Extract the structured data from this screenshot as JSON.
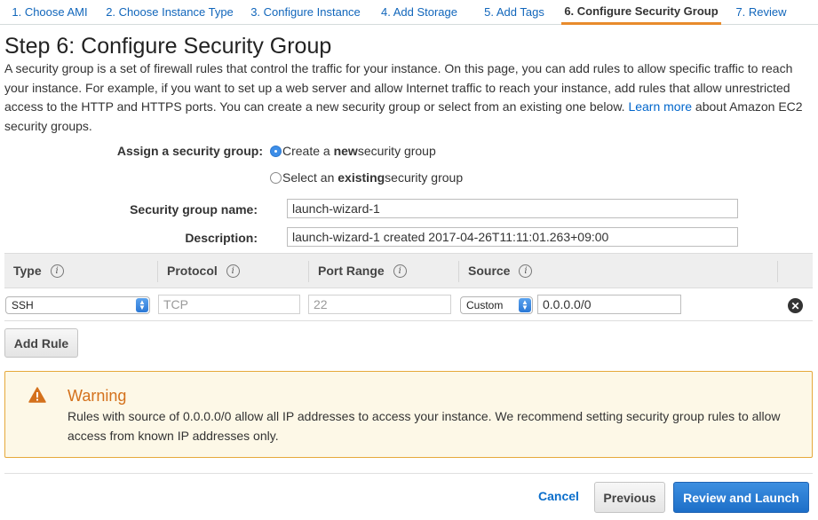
{
  "wizard": {
    "steps": [
      "1. Choose AMI",
      "2. Choose Instance Type",
      "3. Configure Instance",
      "4. Add Storage",
      "5. Add Tags",
      "6. Configure Security Group",
      "7. Review"
    ],
    "active_step": 6
  },
  "page": {
    "title": "Step 6: Configure Security Group",
    "intro_text": "A security group is a set of firewall rules that control the traffic for your instance. On this page, you can add rules to allow specific traffic to reach your instance. For example, if you want to set up a web server and allow Internet traffic to reach your instance, add rules that allow unrestricted access to the HTTP and HTTPS ports. You can create a new security group or select from an existing one below.",
    "learn_more_link": "Learn more",
    "intro_suffix": "about Amazon EC2 security groups."
  },
  "assign": {
    "label": "Assign a security group:",
    "option_new_prefix": "Create a ",
    "option_new_bold": "new",
    "option_new_suffix": " security group",
    "option_existing_prefix": "Select an ",
    "option_existing_bold": "existing",
    "option_existing_suffix": " security group",
    "selected": "new"
  },
  "form": {
    "name_label": "Security group name:",
    "name_value": "launch-wizard-1",
    "desc_label": "Description:",
    "desc_value": "launch-wizard-1 created 2017-04-26T11:11:01.263+09:00"
  },
  "rules_table": {
    "columns": [
      "Type",
      "Protocol",
      "Port Range",
      "Source"
    ],
    "info_glyph": "i",
    "rows": [
      {
        "type": "SSH",
        "protocol": "TCP",
        "port_range": "22",
        "source_mode": "Custom",
        "source_value": "0.0.0.0/0"
      }
    ]
  },
  "buttons": {
    "add_rule": "Add Rule",
    "cancel": "Cancel",
    "previous": "Previous",
    "review_launch": "Review and Launch",
    "remove_glyph": "✕"
  },
  "warning": {
    "title": "Warning",
    "text": "Rules with source of 0.0.0.0/0 allow all IP addresses to access your instance. We recommend setting security group rules to allow access from known IP addresses only.",
    "icon": "warning-triangle-icon",
    "color": "#d4711c"
  },
  "colors": {
    "accent": "#e88b2c",
    "link": "#1166bb",
    "primary_button": "#1d6fc8"
  }
}
